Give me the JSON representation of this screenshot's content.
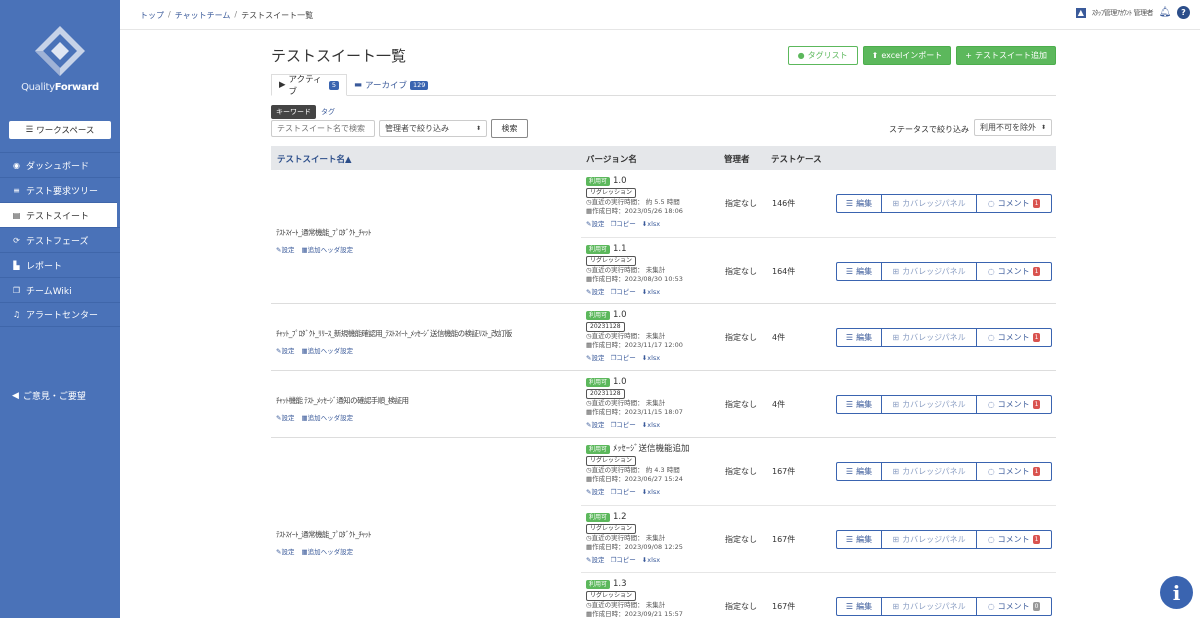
{
  "brand": {
    "name_light": "Quality",
    "name_bold": "Forward"
  },
  "sidebar": {
    "workspace_button": "ワークスペース",
    "items": [
      {
        "label": "ダッシュボード",
        "icon": "dashboard-icon"
      },
      {
        "label": "テスト要求ツリー",
        "icon": "list-icon"
      },
      {
        "label": "テストスイート",
        "icon": "document-icon",
        "active": true
      },
      {
        "label": "テストフェーズ",
        "icon": "phase-icon"
      },
      {
        "label": "レポート",
        "icon": "chart-icon"
      },
      {
        "label": "チームWiki",
        "icon": "wiki-icon"
      },
      {
        "label": "アラートセンター",
        "icon": "bell-icon"
      }
    ],
    "feedback": "ご意見・ご要望"
  },
  "breadcrumb": [
    "トップ",
    "チャットチーム",
    "テストスイート一覧"
  ],
  "header": {
    "user_name": "ｽﾀｯﾌ管理ｱｶｳﾝﾄ 管理者",
    "help": "?"
  },
  "page": {
    "title": "テストスイート一覧",
    "buttons": {
      "tag_list": "タグリスト",
      "excel_import": "excelインポート",
      "add_suite": "テストスイート追加"
    }
  },
  "tabs": [
    {
      "label": "アクティブ",
      "count": "5"
    },
    {
      "label": "アーカイブ",
      "count": "129"
    }
  ],
  "filter": {
    "keyword_tab": "キーワード",
    "tag_tab": "タグ",
    "search_placeholder": "テストスイート名で検索",
    "manager_select": "管理者で絞り込み",
    "search_button": "検索",
    "status_label": "ステータスで絞り込み",
    "status_select": "利用不可を除外"
  },
  "table": {
    "headers": [
      "テストスイート名▲",
      "バージョン名",
      "管理者",
      "テストケース"
    ],
    "suite_links": {
      "settings": "設定",
      "header_settings": "追加ヘッダ設定"
    },
    "version_links": {
      "settings": "設定",
      "copy": "コピー",
      "xlsx": "xlsx"
    },
    "actions": {
      "edit": "編集",
      "coverage": "カバレッジパネル",
      "comment": "コメント"
    },
    "suites": [
      {
        "name": "ﾃｽﾄｽｲｰﾄ_通常機能_ﾌﾟﾛﾀﾞｸﾄ_ﾁｬｯﾄ",
        "versions": [
          {
            "status": "利用可",
            "name": "1.0",
            "tag": "リグレッション",
            "last_run": "直近の実行時間： 約 5.5 時間",
            "created": "作成日時：2023/05/26 18:06",
            "manager": "指定なし",
            "cases": "146件",
            "comments": "1"
          },
          {
            "status": "利用可",
            "name": "1.1",
            "tag": "リグレッション",
            "last_run": "直近の実行時間： 未集計",
            "created": "作成日時：2023/08/30 10:53",
            "manager": "指定なし",
            "cases": "164件",
            "comments": "1"
          }
        ]
      },
      {
        "name": "ﾁｬｯﾄ_ﾌﾟﾛﾀﾞｸﾄ_ﾘﾘｰｽ_新規機能確認用_ﾃｽﾄｽｲｰﾄ_ﾒｯｾｰｼﾞ送信機能の検証ﾘｽﾄ_改訂版",
        "versions": [
          {
            "status": "利用可",
            "name": "1.0",
            "tag": "20231128",
            "last_run": "直近の実行時間： 未集計",
            "created": "作成日時：2023/11/17 12:00",
            "manager": "指定なし",
            "cases": "4件",
            "comments": "1"
          }
        ]
      },
      {
        "name": "ﾁｬｯﾄ機能 ﾃｽﾄ_ﾒｯｾｰｼﾞ通知の確認手順_検証用",
        "versions": [
          {
            "status": "利用可",
            "name": "1.0",
            "tag": "20231128",
            "last_run": "直近の実行時間： 未集計",
            "created": "作成日時：2023/11/15 18:07",
            "manager": "指定なし",
            "cases": "4件",
            "comments": "1"
          }
        ]
      },
      {
        "name": "ﾃｽﾄｽｲｰﾄ_通常機能_ﾌﾟﾛﾀﾞｸﾄ_ﾁｬｯﾄ",
        "versions": [
          {
            "status": "利用可",
            "name": "ﾒｯｾｰｼﾞ送信機能追加",
            "tag": "リグレッション",
            "last_run": "直近の実行時間： 約 4.3 時間",
            "created": "作成日時：2023/06/27 15:24",
            "manager": "指定なし",
            "cases": "167件",
            "comments": "1"
          },
          {
            "status": "利用可",
            "name": "1.2",
            "tag": "リグレッション",
            "last_run": "直近の実行時間： 未集計",
            "created": "作成日時：2023/09/08 12:25",
            "manager": "指定なし",
            "cases": "167件",
            "comments": "1"
          },
          {
            "status": "利用可",
            "name": "1.3",
            "tag": "リグレッション",
            "last_run": "直近の実行時間： 未集計",
            "created": "作成日時：2023/09/21 15:57",
            "manager": "指定なし",
            "cases": "167件",
            "comments": "0"
          }
        ]
      }
    ]
  },
  "colors": {
    "sidebar": "#4a72b8",
    "accent": "#3a64b0",
    "success": "#5cb85c",
    "danger": "#d9534f"
  }
}
